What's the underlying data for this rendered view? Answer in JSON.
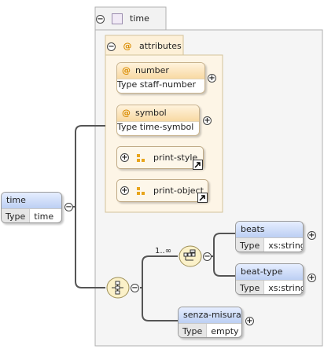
{
  "root_element": {
    "name": "time",
    "type_key": "Type",
    "type_value": "time"
  },
  "complex_type": {
    "name": "time"
  },
  "attributes_group": {
    "label": "attributes"
  },
  "attributes": [
    {
      "symbol": "@",
      "name": "number",
      "type_key": "Type",
      "type_value": "staff-number"
    },
    {
      "symbol": "@",
      "name": "symbol",
      "type_key": "Type",
      "type_value": "time-symbol"
    }
  ],
  "attribute_groups": [
    {
      "name": "print-style"
    },
    {
      "name": "print-object"
    }
  ],
  "inner_sequence": {
    "cardinality": "1..∞"
  },
  "elements": {
    "beats": {
      "name": "beats",
      "type_key": "Type",
      "type_value": "xs:string"
    },
    "beat_type": {
      "name": "beat-type",
      "type_key": "Type",
      "type_value": "xs:string"
    },
    "senza_misura": {
      "name": "senza-misura",
      "type_key": "Type",
      "type_value": "empty"
    }
  },
  "glyphs": {
    "collapse": "−",
    "expand": "+"
  },
  "icons": [
    "collapse-icon",
    "expand-icon",
    "checkbox-icon",
    "attribute-group-icon",
    "reference-arrow-icon",
    "choice-compositor-icon",
    "sequence-compositor-icon"
  ],
  "colors": {
    "element_header": "#bccff3",
    "attribute_header": "#f8d9a3",
    "group_fill": "#fdf7ea",
    "compositor_fill": "#fbf1c9",
    "wire": "#555555"
  }
}
